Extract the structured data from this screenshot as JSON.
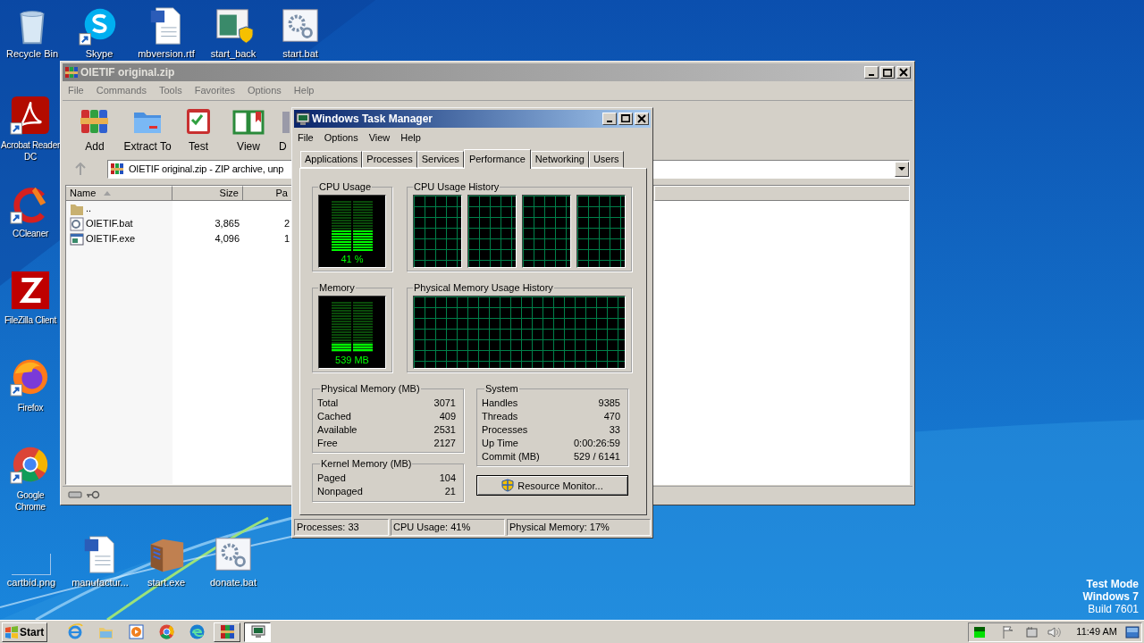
{
  "desktop_icons": [
    {
      "label": "Recycle Bin",
      "kind": "recycle",
      "shortcut": false
    },
    {
      "label": "Skype",
      "kind": "skype",
      "shortcut": true
    },
    {
      "label": "mbversion.rtf",
      "kind": "word",
      "shortcut": false
    },
    {
      "label": "start_back",
      "kind": "window",
      "shortcut": false
    },
    {
      "label": "start.bat",
      "kind": "gear",
      "shortcut": false
    },
    {
      "label": "Acrobat Reader DC",
      "kind": "acrobat",
      "shortcut": true
    },
    {
      "label": "CCleaner",
      "kind": "ccleaner",
      "shortcut": true
    },
    {
      "label": "FileZilla Client",
      "kind": "filezilla",
      "shortcut": false
    },
    {
      "label": "Firefox",
      "kind": "firefox",
      "shortcut": true
    },
    {
      "label": "Google Chrome",
      "kind": "chrome",
      "shortcut": true
    },
    {
      "label": "cartbid.png",
      "kind": "blank",
      "shortcut": false
    },
    {
      "label": "manufactur...",
      "kind": "word",
      "shortcut": false
    },
    {
      "label": "start.exe",
      "kind": "sfx",
      "shortcut": false
    },
    {
      "label": "donate.bat",
      "kind": "gear",
      "shortcut": false
    }
  ],
  "winrar": {
    "title": "OIETIF original.zip",
    "menu": [
      "File",
      "Commands",
      "Tools",
      "Favorites",
      "Options",
      "Help"
    ],
    "toolbar": [
      {
        "label": "Add",
        "kind": "add"
      },
      {
        "label": "Extract To",
        "kind": "extract"
      },
      {
        "label": "Test",
        "kind": "test"
      },
      {
        "label": "View",
        "kind": "view"
      },
      {
        "label": "D",
        "kind": "delete"
      }
    ],
    "address": "OIETIF original.zip - ZIP archive, unp",
    "columns": [
      "Name",
      "Size",
      "Pa"
    ],
    "rows": [
      {
        "kind": "up",
        "name": ".."
      },
      {
        "kind": "bat",
        "name": "OIETIF.bat",
        "size": "3,865",
        "column_3": "2"
      },
      {
        "kind": "exe",
        "name": "OIETIF.exe",
        "size": "4,096",
        "column_3": "1"
      }
    ]
  },
  "task_manager": {
    "title": "Windows Task Manager",
    "menu": [
      "File",
      "Options",
      "View",
      "Help"
    ],
    "tabs": [
      {
        "label": "Applications",
        "selected": false
      },
      {
        "label": "Processes",
        "selected": false
      },
      {
        "label": "Services",
        "selected": false
      },
      {
        "label": "Performance",
        "selected": true
      },
      {
        "label": "Networking",
        "selected": false
      },
      {
        "label": "Users",
        "selected": false
      }
    ],
    "cpu_usage": {
      "title": "CPU Usage",
      "reading": "41 %",
      "level": 0.41
    },
    "cpu_history": {
      "title": "CPU Usage History"
    },
    "memory": {
      "title": "Memory",
      "reading": "539 MB",
      "level": 0.17
    },
    "memory_history": {
      "title": "Physical Memory Usage History"
    },
    "physical_memory": {
      "title": "Physical Memory (MB)",
      "rows": [
        {
          "label": "Total",
          "value": "3071"
        },
        {
          "label": "Cached",
          "value": "409"
        },
        {
          "label": "Available",
          "value": "2531"
        },
        {
          "label": "Free",
          "value": "2127"
        }
      ]
    },
    "kernel_memory": {
      "title": "Kernel Memory (MB)",
      "rows": [
        {
          "label": "Paged",
          "value": "104"
        },
        {
          "label": "Nonpaged",
          "value": "21"
        }
      ]
    },
    "system": {
      "title": "System",
      "rows": [
        {
          "label": "Handles",
          "value": "9385"
        },
        {
          "label": "Threads",
          "value": "470"
        },
        {
          "label": "Processes",
          "value": "33"
        },
        {
          "label": "Up Time",
          "value": "0:00:26:59"
        },
        {
          "label": "Commit (MB)",
          "value": "529 / 6141"
        }
      ]
    },
    "resource_button": "Resource Monitor...",
    "status_bar": [
      "Processes: 33",
      "CPU Usage: 41%",
      "Physical Memory: 17%"
    ]
  },
  "os_notice": [
    "Test Mode",
    "Windows 7",
    "Build 7601"
  ],
  "taskbar": {
    "start": "Start",
    "apps": [
      {
        "kind": "ie",
        "open": false
      },
      {
        "kind": "explorer",
        "open": false
      },
      {
        "kind": "media",
        "open": false
      },
      {
        "kind": "chrome",
        "open": false
      },
      {
        "kind": "edge",
        "open": false
      },
      {
        "kind": "winrar",
        "open": true
      },
      {
        "kind": "taskmgr",
        "open": true
      }
    ],
    "time": "11:49 AM"
  }
}
